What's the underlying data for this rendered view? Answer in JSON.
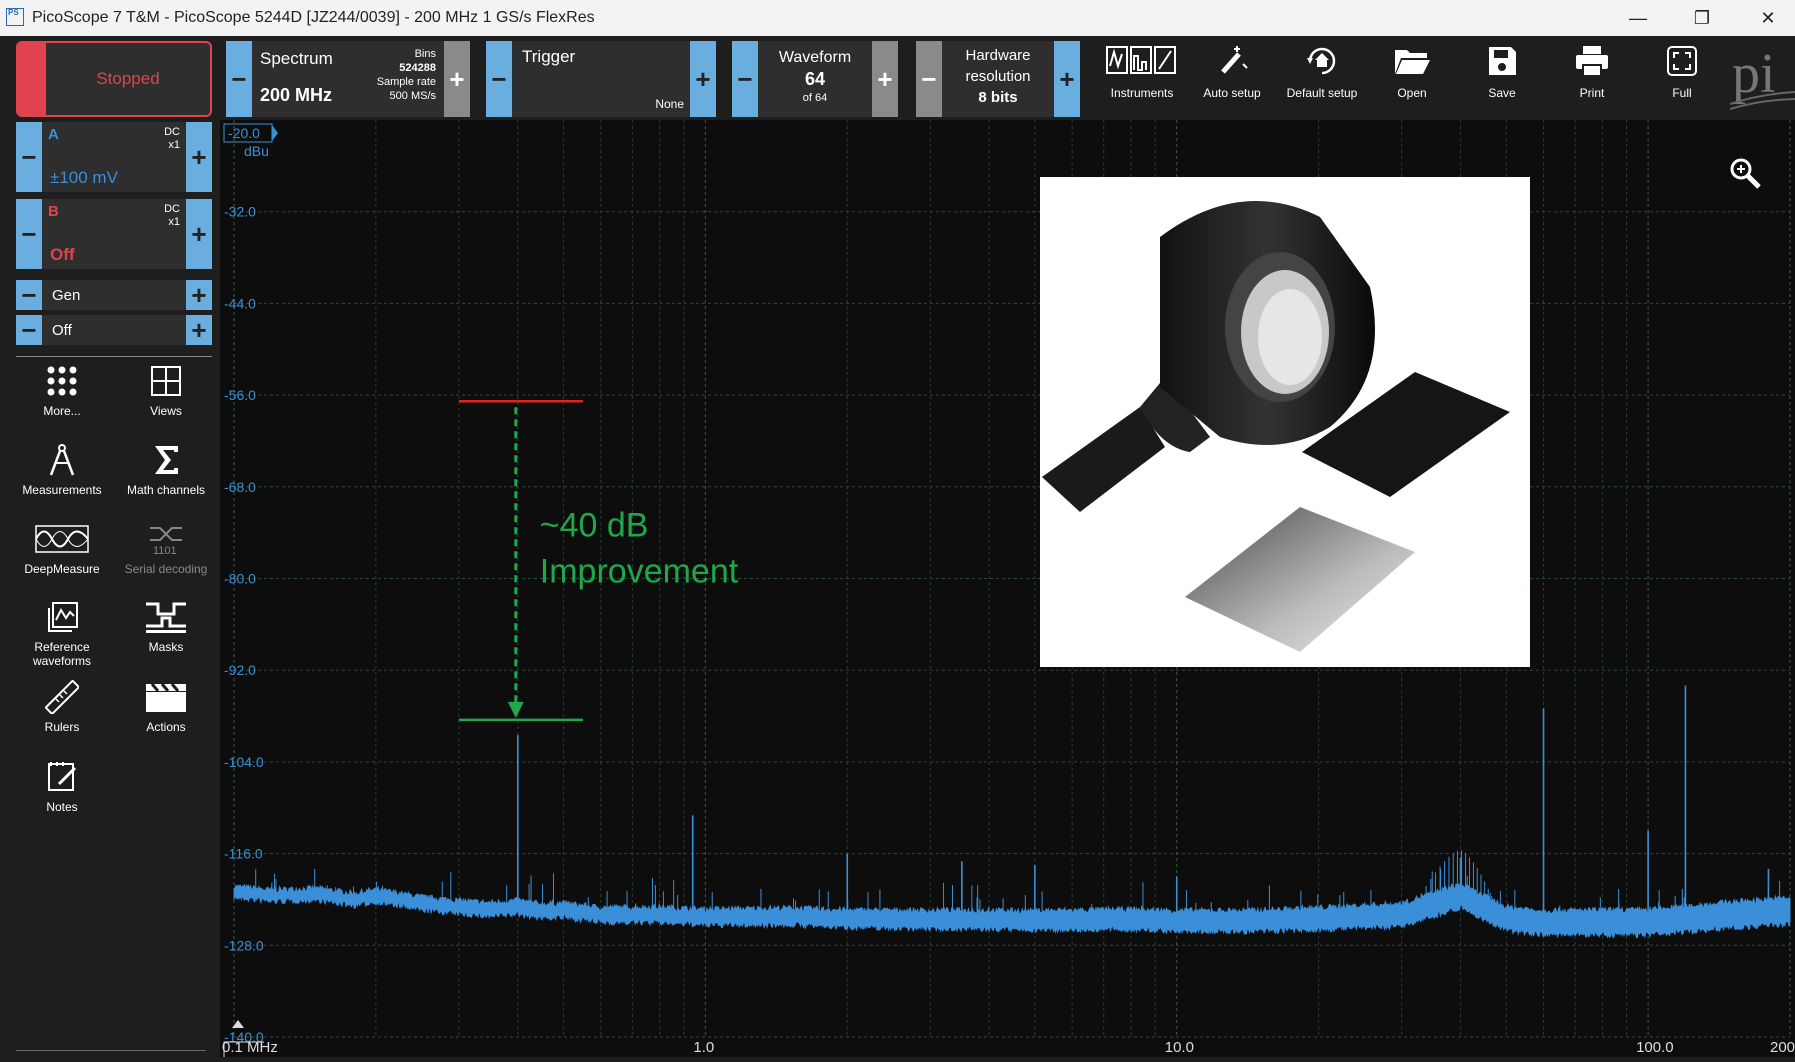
{
  "window": {
    "title": "PicoScope 7 T&M  - PicoScope 5244D [JZ244/0039] - 200 MHz 1 GS/s FlexRes",
    "logo_text": "PS",
    "minimize": "—",
    "restore": "❐",
    "close": "✕"
  },
  "toolbar": {
    "run_state": "Stopped",
    "spectrum": {
      "label": "Spectrum",
      "value": "200 MHz",
      "bins_label": "Bins",
      "bins_value": "524288",
      "rate_label": "Sample rate",
      "rate_value": "500 MS/s"
    },
    "trigger": {
      "label": "Trigger",
      "value": "None"
    },
    "waveform": {
      "label": "Waveform",
      "value": "64",
      "sub": "of 64"
    },
    "hardware": {
      "label1": "Hardware",
      "label2": "resolution",
      "value": "8 bits"
    },
    "actions": [
      "Instruments",
      "Auto setup",
      "Default setup",
      "Open",
      "Save",
      "Print",
      "Full"
    ],
    "minus": "−",
    "plus": "+"
  },
  "channels": {
    "a": {
      "name": "A",
      "coupling": "DC",
      "probe": "x1",
      "range": "±100 mV",
      "color": "#3a8fd8"
    },
    "b": {
      "name": "B",
      "coupling": "DC",
      "probe": "x1",
      "range": "Off",
      "color": "#e0434d"
    },
    "gen": {
      "label": "Gen",
      "state": "Off"
    }
  },
  "sidebar": {
    "items": [
      "More...",
      "Views",
      "Measurements",
      "Math channels",
      "DeepMeasure",
      "Serial decoding",
      "Reference waveforms",
      "Masks",
      "Rulers",
      "Actions",
      "Notes"
    ]
  },
  "plot": {
    "axis_top_label": "-20.0",
    "axis_unit": "dBu",
    "y_ticks": [
      "-32.0",
      "-44.0",
      "-56.0",
      "-68.0",
      "-80.0",
      "-92.0",
      "-104.0",
      "-116.0",
      "-128.0",
      "-140.0"
    ],
    "x_ticks": [
      "0.1 MHz",
      "1.0",
      "10.0",
      "100.0",
      "200."
    ],
    "annotation_line1": "~40 dB",
    "annotation_line2": "Improvement",
    "trace_color": "#3a8fd8",
    "annotation_color": "#1fa84a",
    "top_marker_color": "#e0231f"
  },
  "chart_data": {
    "type": "line",
    "x_scale": "log",
    "xlim": [
      0.1,
      200
    ],
    "ylim": [
      -140,
      -20
    ],
    "x_unit": "MHz",
    "y_unit": "dBu",
    "series": [
      {
        "x": [
          0.1,
          0.12,
          0.15,
          0.18,
          0.2,
          0.25,
          0.3,
          0.35,
          0.4,
          0.45,
          0.5,
          0.6,
          0.8,
          1.0,
          1.5,
          2,
          3,
          5,
          8,
          10,
          15,
          20,
          30,
          40,
          50,
          60,
          80,
          100,
          150,
          200
        ],
        "y": [
          -121.0,
          -121.5,
          -121.3,
          -122.0,
          -121.5,
          -122.5,
          -123.0,
          -123.3,
          -123.0,
          -123.5,
          -123.4,
          -124.0,
          -124.0,
          -124.3,
          -124.2,
          -124.5,
          -124.6,
          -124.7,
          -124.6,
          -124.8,
          -124.8,
          -124.5,
          -124.0,
          -121.5,
          -124.5,
          -125.0,
          -125.0,
          -125.0,
          -124.0,
          -123.5
        ]
      }
    ],
    "spurs": [
      {
        "x": 0.4,
        "y": -100.5
      },
      {
        "x": 0.94,
        "y": -111
      },
      {
        "x": 2.0,
        "y": -116
      },
      {
        "x": 3.5,
        "y": -117
      },
      {
        "x": 5.0,
        "y": -117.5
      },
      {
        "x": 10.0,
        "y": -119
      },
      {
        "x": 40.0,
        "y": -116.5
      },
      {
        "x": 60.0,
        "y": -97
      },
      {
        "x": 100.0,
        "y": -113
      },
      {
        "x": 120.0,
        "y": -94
      },
      {
        "x": 180.0,
        "y": -118
      }
    ],
    "annotation": {
      "top_level": -56.8,
      "bottom_level": -98.5,
      "x_from": 0.3,
      "x_to": 0.55,
      "x_arrow": 0.4
    }
  }
}
